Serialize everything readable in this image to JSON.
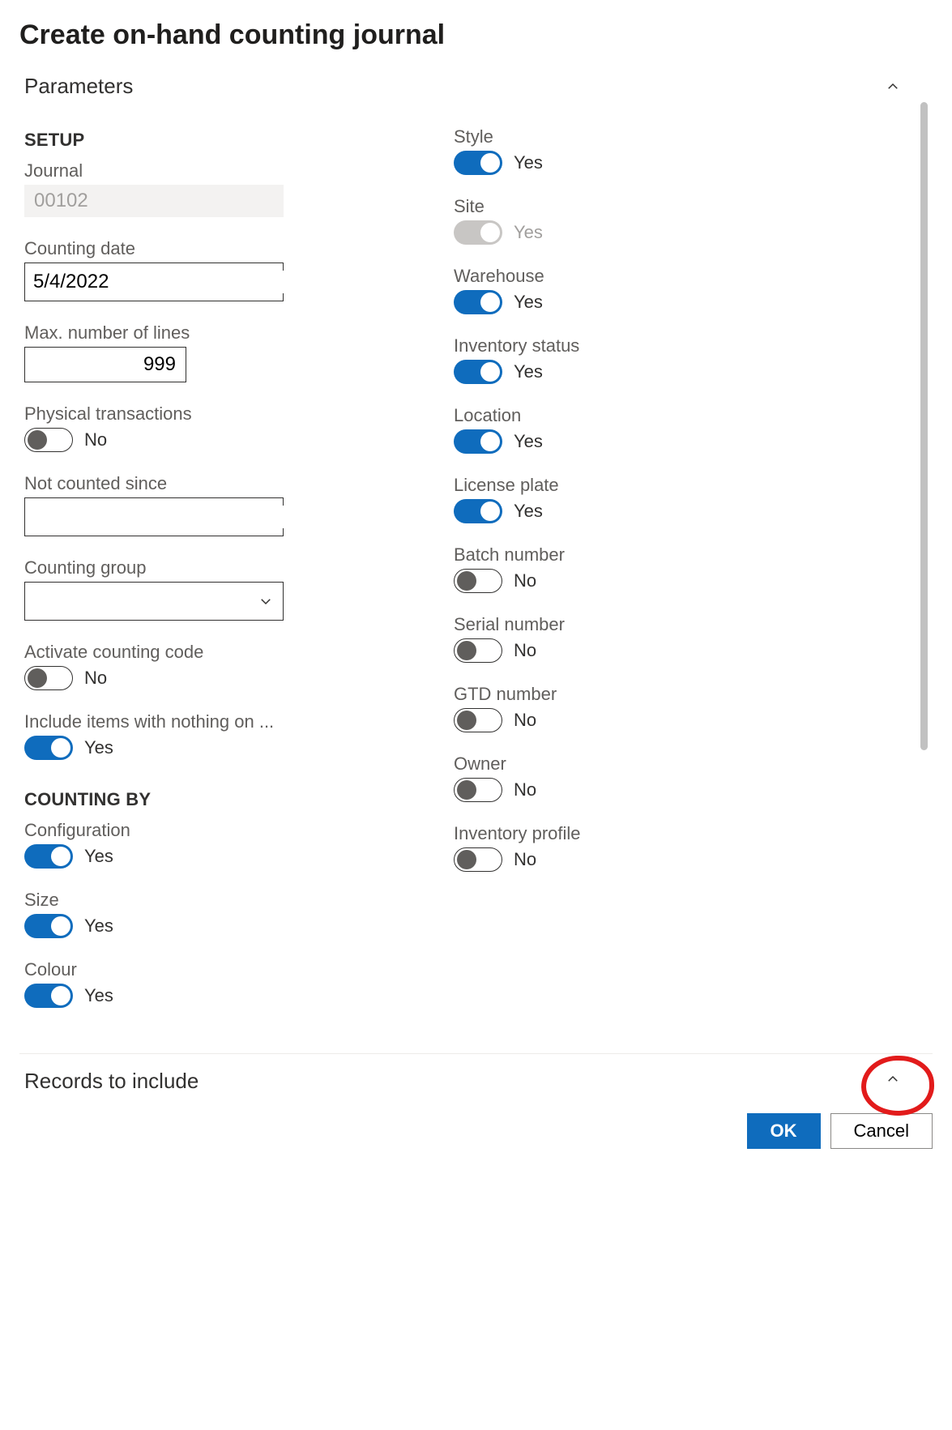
{
  "dialog": {
    "title": "Create on-hand counting journal"
  },
  "sections": {
    "parameters": {
      "title": "Parameters"
    },
    "records": {
      "title": "Records to include"
    }
  },
  "setup": {
    "heading": "SETUP",
    "journal": {
      "label": "Journal",
      "value": "00102"
    },
    "countingDate": {
      "label": "Counting date",
      "value": "5/4/2022"
    },
    "maxLines": {
      "label": "Max. number of lines",
      "value": "999"
    },
    "physicalTrans": {
      "label": "Physical transactions",
      "state": "No"
    },
    "notCountedSince": {
      "label": "Not counted since",
      "value": ""
    },
    "countingGroup": {
      "label": "Counting group",
      "value": ""
    },
    "activateCountingCode": {
      "label": "Activate counting code",
      "state": "No"
    },
    "includeNothingOnHand": {
      "label": "Include items with nothing on ...",
      "state": "Yes"
    }
  },
  "countingBy": {
    "heading": "COUNTING BY",
    "configuration": {
      "label": "Configuration",
      "state": "Yes"
    },
    "size": {
      "label": "Size",
      "state": "Yes"
    },
    "colour": {
      "label": "Colour",
      "state": "Yes"
    },
    "style": {
      "label": "Style",
      "state": "Yes"
    },
    "site": {
      "label": "Site",
      "state": "Yes",
      "disabled": true
    },
    "warehouse": {
      "label": "Warehouse",
      "state": "Yes"
    },
    "inventoryStatus": {
      "label": "Inventory status",
      "state": "Yes"
    },
    "location": {
      "label": "Location",
      "state": "Yes"
    },
    "licensePlate": {
      "label": "License plate",
      "state": "Yes"
    },
    "batchNumber": {
      "label": "Batch number",
      "state": "No"
    },
    "serialNumber": {
      "label": "Serial number",
      "state": "No"
    },
    "gtdNumber": {
      "label": "GTD number",
      "state": "No"
    },
    "owner": {
      "label": "Owner",
      "state": "No"
    },
    "inventoryProfile": {
      "label": "Inventory profile",
      "state": "No"
    }
  },
  "buttons": {
    "ok": "OK",
    "cancel": "Cancel"
  }
}
